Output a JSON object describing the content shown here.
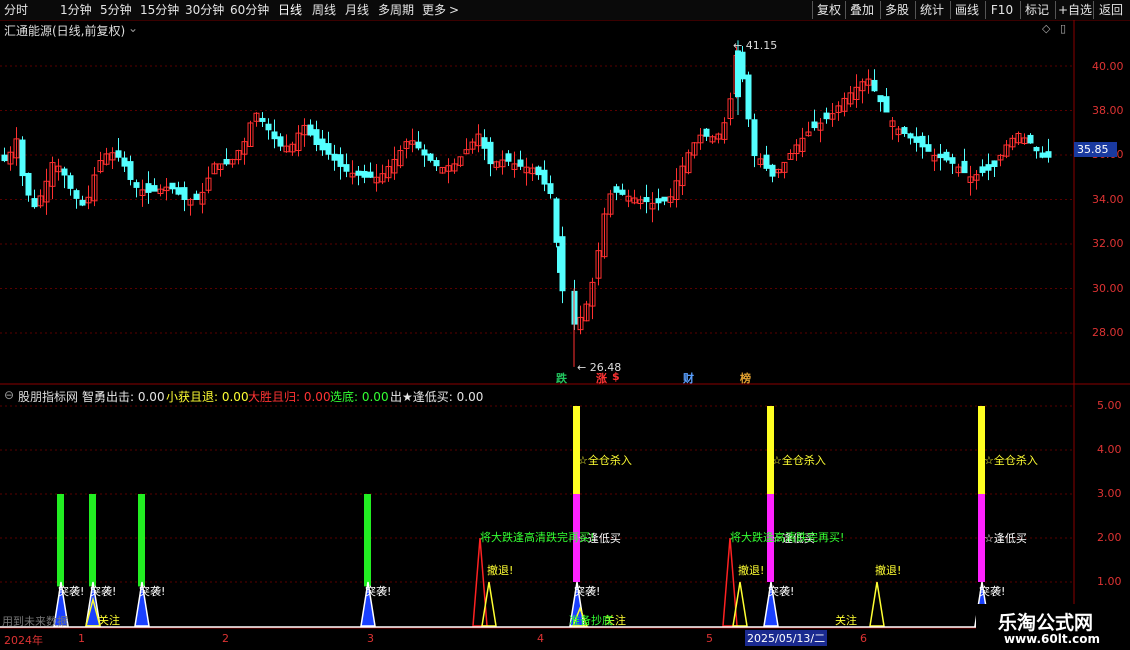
{
  "toolbar": {
    "periods": [
      "分时",
      "1分钟",
      "5分钟",
      "15分钟",
      "30分钟",
      "60分钟",
      "日线",
      "周线",
      "月线",
      "多周期",
      "更多"
    ],
    "active_period": "日线",
    "more_arrow": ">",
    "right_buttons": [
      "复权",
      "叠加",
      "多股",
      "统计",
      "画线",
      "F10",
      "标记",
      "+自选",
      "返回"
    ]
  },
  "main_panel": {
    "title": "汇通能源(日线,前复权)",
    "high_label": "41.15",
    "low_label": "26.48",
    "current_price": "35.85",
    "y_ticks": [
      "40.00",
      "38.00",
      "36.00",
      "34.00",
      "32.00",
      "30.00",
      "28.00"
    ],
    "event_tags": [
      {
        "text": "跌",
        "color": "#22c55e"
      },
      {
        "text": "涨",
        "color": "#ff3333"
      },
      {
        "text": "$",
        "color": "#ff3333"
      },
      {
        "text": "财",
        "color": "#5aa0ff"
      },
      {
        "text": "榜",
        "color": "#e0a030"
      }
    ]
  },
  "indicator_panel": {
    "name": "股朋指标网",
    "legend": [
      {
        "label": "智勇出击: 0.00",
        "color": "#e6e6e6"
      },
      {
        "label": "小获且退: 0.00",
        "color": "#ffff33"
      },
      {
        "label": "大胜且归: 0.00",
        "color": "#ff3333"
      },
      {
        "label": "选底: 0.00",
        "color": "#33ff33"
      },
      {
        "label": "出★逢低买: 0.00",
        "color": "#e6e6e6"
      }
    ],
    "y_ticks": [
      "5.00",
      "4.00",
      "3.00",
      "2.00",
      "1.00"
    ],
    "annotations": {
      "attack": "突袭!",
      "buy_all": "☆全仓杀入",
      "dip_buy": "☆逢低买",
      "big_drop": "将大跌逢高清跌完再买!",
      "retreat": "撤退!",
      "watch": "关注",
      "bottom_fish": "准备抄底"
    },
    "bottom_left_text": "用到未来数据"
  },
  "timeline": {
    "labels": [
      {
        "text": "2024年",
        "highlight": false
      },
      {
        "text": "1",
        "highlight": false
      },
      {
        "text": "2",
        "highlight": false
      },
      {
        "text": "3",
        "highlight": false
      },
      {
        "text": "4",
        "highlight": false
      },
      {
        "text": "5",
        "highlight": false
      },
      {
        "text": "2025/05/13/二",
        "highlight": true
      },
      {
        "text": "6",
        "highlight": false
      }
    ]
  },
  "watermark": {
    "title": "乐淘公式网",
    "url": "www.60lt.com"
  },
  "chart_data": {
    "type": "candlestick",
    "title": "汇通能源(日线,前复权)",
    "x_range": [
      "2024-12",
      "2025-06"
    ],
    "ylim": [
      26,
      42
    ],
    "high": 41.15,
    "low": 26.48,
    "last": 35.85,
    "colors": {
      "up": "#ff3030",
      "down": "#54ffff"
    }
  }
}
